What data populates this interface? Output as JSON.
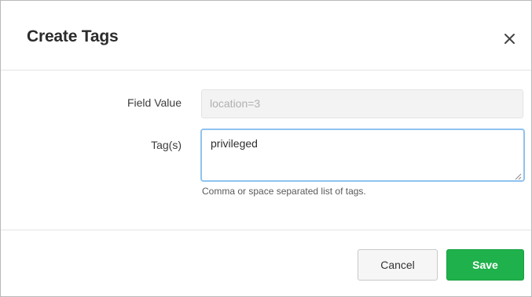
{
  "dialog": {
    "title": "Create Tags",
    "close_icon": "close-icon"
  },
  "form": {
    "field_value_label": "Field Value",
    "field_value_value": "location=3",
    "field_value_disabled": true,
    "tags_label": "Tag(s)",
    "tags_value": "privileged",
    "tags_help": "Comma or space separated list of tags."
  },
  "footer": {
    "cancel_label": "Cancel",
    "save_label": "Save"
  },
  "colors": {
    "save_button": "#1fb14b",
    "focus_border": "#8fc2f0",
    "disabled_bg": "#f3f3f3"
  }
}
